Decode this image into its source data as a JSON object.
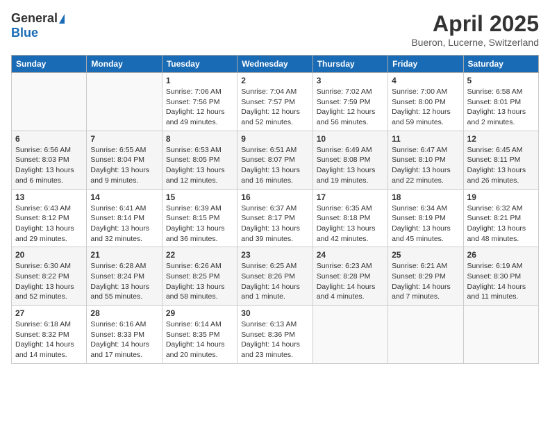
{
  "header": {
    "logo_general": "General",
    "logo_blue": "Blue",
    "title": "April 2025",
    "location": "Bueron, Lucerne, Switzerland"
  },
  "days_of_week": [
    "Sunday",
    "Monday",
    "Tuesday",
    "Wednesday",
    "Thursday",
    "Friday",
    "Saturday"
  ],
  "weeks": [
    [
      {
        "day": "",
        "detail": ""
      },
      {
        "day": "",
        "detail": ""
      },
      {
        "day": "1",
        "detail": "Sunrise: 7:06 AM\nSunset: 7:56 PM\nDaylight: 12 hours and 49 minutes."
      },
      {
        "day": "2",
        "detail": "Sunrise: 7:04 AM\nSunset: 7:57 PM\nDaylight: 12 hours and 52 minutes."
      },
      {
        "day": "3",
        "detail": "Sunrise: 7:02 AM\nSunset: 7:59 PM\nDaylight: 12 hours and 56 minutes."
      },
      {
        "day": "4",
        "detail": "Sunrise: 7:00 AM\nSunset: 8:00 PM\nDaylight: 12 hours and 59 minutes."
      },
      {
        "day": "5",
        "detail": "Sunrise: 6:58 AM\nSunset: 8:01 PM\nDaylight: 13 hours and 2 minutes."
      }
    ],
    [
      {
        "day": "6",
        "detail": "Sunrise: 6:56 AM\nSunset: 8:03 PM\nDaylight: 13 hours and 6 minutes."
      },
      {
        "day": "7",
        "detail": "Sunrise: 6:55 AM\nSunset: 8:04 PM\nDaylight: 13 hours and 9 minutes."
      },
      {
        "day": "8",
        "detail": "Sunrise: 6:53 AM\nSunset: 8:05 PM\nDaylight: 13 hours and 12 minutes."
      },
      {
        "day": "9",
        "detail": "Sunrise: 6:51 AM\nSunset: 8:07 PM\nDaylight: 13 hours and 16 minutes."
      },
      {
        "day": "10",
        "detail": "Sunrise: 6:49 AM\nSunset: 8:08 PM\nDaylight: 13 hours and 19 minutes."
      },
      {
        "day": "11",
        "detail": "Sunrise: 6:47 AM\nSunset: 8:10 PM\nDaylight: 13 hours and 22 minutes."
      },
      {
        "day": "12",
        "detail": "Sunrise: 6:45 AM\nSunset: 8:11 PM\nDaylight: 13 hours and 26 minutes."
      }
    ],
    [
      {
        "day": "13",
        "detail": "Sunrise: 6:43 AM\nSunset: 8:12 PM\nDaylight: 13 hours and 29 minutes."
      },
      {
        "day": "14",
        "detail": "Sunrise: 6:41 AM\nSunset: 8:14 PM\nDaylight: 13 hours and 32 minutes."
      },
      {
        "day": "15",
        "detail": "Sunrise: 6:39 AM\nSunset: 8:15 PM\nDaylight: 13 hours and 36 minutes."
      },
      {
        "day": "16",
        "detail": "Sunrise: 6:37 AM\nSunset: 8:17 PM\nDaylight: 13 hours and 39 minutes."
      },
      {
        "day": "17",
        "detail": "Sunrise: 6:35 AM\nSunset: 8:18 PM\nDaylight: 13 hours and 42 minutes."
      },
      {
        "day": "18",
        "detail": "Sunrise: 6:34 AM\nSunset: 8:19 PM\nDaylight: 13 hours and 45 minutes."
      },
      {
        "day": "19",
        "detail": "Sunrise: 6:32 AM\nSunset: 8:21 PM\nDaylight: 13 hours and 48 minutes."
      }
    ],
    [
      {
        "day": "20",
        "detail": "Sunrise: 6:30 AM\nSunset: 8:22 PM\nDaylight: 13 hours and 52 minutes."
      },
      {
        "day": "21",
        "detail": "Sunrise: 6:28 AM\nSunset: 8:24 PM\nDaylight: 13 hours and 55 minutes."
      },
      {
        "day": "22",
        "detail": "Sunrise: 6:26 AM\nSunset: 8:25 PM\nDaylight: 13 hours and 58 minutes."
      },
      {
        "day": "23",
        "detail": "Sunrise: 6:25 AM\nSunset: 8:26 PM\nDaylight: 14 hours and 1 minute."
      },
      {
        "day": "24",
        "detail": "Sunrise: 6:23 AM\nSunset: 8:28 PM\nDaylight: 14 hours and 4 minutes."
      },
      {
        "day": "25",
        "detail": "Sunrise: 6:21 AM\nSunset: 8:29 PM\nDaylight: 14 hours and 7 minutes."
      },
      {
        "day": "26",
        "detail": "Sunrise: 6:19 AM\nSunset: 8:30 PM\nDaylight: 14 hours and 11 minutes."
      }
    ],
    [
      {
        "day": "27",
        "detail": "Sunrise: 6:18 AM\nSunset: 8:32 PM\nDaylight: 14 hours and 14 minutes."
      },
      {
        "day": "28",
        "detail": "Sunrise: 6:16 AM\nSunset: 8:33 PM\nDaylight: 14 hours and 17 minutes."
      },
      {
        "day": "29",
        "detail": "Sunrise: 6:14 AM\nSunset: 8:35 PM\nDaylight: 14 hours and 20 minutes."
      },
      {
        "day": "30",
        "detail": "Sunrise: 6:13 AM\nSunset: 8:36 PM\nDaylight: 14 hours and 23 minutes."
      },
      {
        "day": "",
        "detail": ""
      },
      {
        "day": "",
        "detail": ""
      },
      {
        "day": "",
        "detail": ""
      }
    ]
  ]
}
